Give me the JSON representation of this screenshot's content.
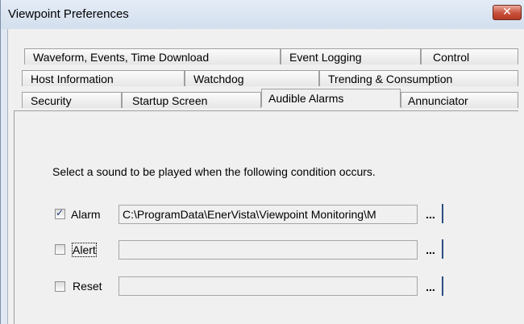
{
  "window": {
    "title": "Viewpoint Preferences",
    "close_glyph": "✕"
  },
  "tabs": {
    "row1": [
      "Waveform, Events, Time Download",
      "Event Logging",
      "Control"
    ],
    "row2": [
      "Host Information",
      "Watchdog",
      "Trending & Consumption"
    ],
    "row3": [
      "Security",
      "Startup Screen",
      "Audible Alarms",
      "Annunciator"
    ],
    "active": "Audible Alarms"
  },
  "audible_alarms": {
    "instruction": "Select a sound to be played when the following condition occurs.",
    "rows": [
      {
        "label": "Alarm",
        "checked": true,
        "path": "C:\\ProgramData\\EnerVista\\Viewpoint Monitoring\\M",
        "browse": "..."
      },
      {
        "label": "Alert",
        "checked": false,
        "path": "",
        "browse": "..."
      },
      {
        "label": "Reset",
        "checked": false,
        "path": "",
        "browse": "..."
      }
    ]
  },
  "icons": {
    "check": "✓"
  }
}
